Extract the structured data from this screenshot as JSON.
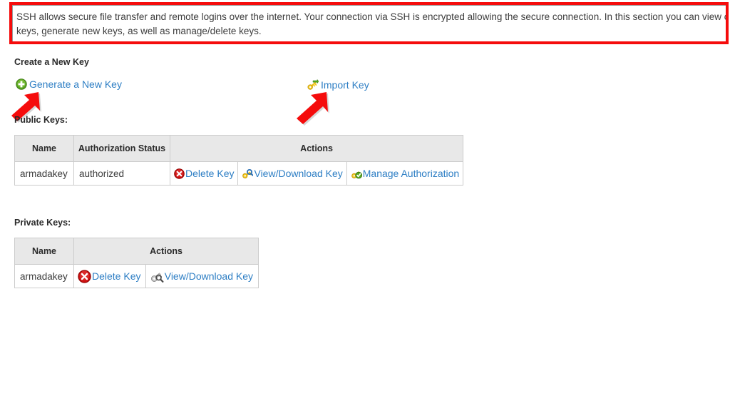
{
  "intro": {
    "text": "SSH allows secure file transfer and remote logins over the internet. Your connection via SSH is encrypted allowing the secure connection. In this section you can view current keys, generate new keys, as well as manage/delete keys.",
    "highlight_color": "#f50c0c"
  },
  "create_section": {
    "heading": "Create a New Key",
    "generate_link": "Generate a New Key",
    "generate_icon": "green-plus-circle-icon",
    "import_link": "Import Key",
    "import_icon": "key-import-icon"
  },
  "annotations": {
    "arrow_color": "#f50c0c",
    "arrow_generate": "arrow-pointing-to-generate-a-new-key",
    "arrow_import": "arrow-pointing-to-import-key"
  },
  "public_keys": {
    "heading": "Public Keys:",
    "columns": [
      "Name",
      "Authorization Status",
      "Actions"
    ],
    "rows": [
      {
        "name": "armadakey",
        "status": "authorized",
        "actions": [
          {
            "label": "Delete Key",
            "icon": "red-delete-circle-icon"
          },
          {
            "label": "View/Download Key",
            "icon": "key-view-icon"
          },
          {
            "label": "Manage Authorization",
            "icon": "key-authorize-icon"
          }
        ]
      }
    ]
  },
  "private_keys": {
    "heading": "Private Keys:",
    "columns": [
      "Name",
      "Actions"
    ],
    "rows": [
      {
        "name": "armadakey",
        "actions": [
          {
            "label": "Delete Key",
            "icon": "red-delete-circle-icon"
          },
          {
            "label": "View/Download Key",
            "icon": "key-magnifier-icon"
          }
        ]
      }
    ]
  },
  "colors": {
    "link": "#2d7ec4",
    "table_header_bg": "#e8e8e8",
    "table_border": "#cccccc",
    "text": "#3c3c3c"
  }
}
